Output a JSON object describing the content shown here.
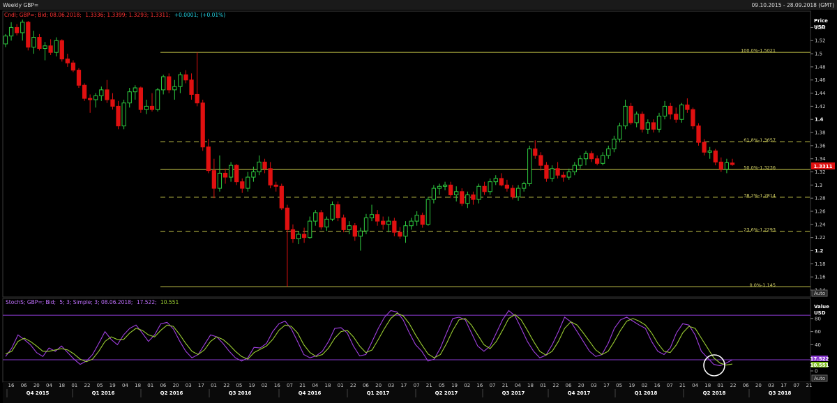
{
  "window": {
    "title": "Weekly GBP=",
    "date_range": "09.10.2015 - 28.09.2018 (GMT)"
  },
  "price_panel": {
    "legend_prefix": "Cndl; GBP=; Bid; 08.06.2018;",
    "legend_values": "1.3336; 1.3399; 1.3293; 1.3311;",
    "legend_change": "+0.0001; (+0.01%)",
    "axis_title_1": "Price",
    "axis_title_2": "USD",
    "last_price": "1.3311",
    "auto_label": "Auto"
  },
  "stoch_panel": {
    "legend_prefix": "StochS; GBP=; Bid;",
    "legend_params": "5; 3; Simple; 3; 08.06.2018;",
    "legend_k": "17.522;",
    "legend_d": "10.551",
    "axis_title_1": "Value",
    "axis_title_2": "USD",
    "k_value": "17.522",
    "d_value": "10.551",
    "auto_label": "Auto"
  },
  "colors": {
    "background": "#000000",
    "up_candle": "#2ecc40",
    "down_candle": "#e01010",
    "fib_line": "#c8c84a",
    "stoch_k": "#a040e0",
    "stoch_d": "#9acd32",
    "stoch_band": "#8a3ad0"
  },
  "chart_data": [
    {
      "type": "candlestick",
      "title": "Weekly GBP=",
      "ylabel": "Price USD",
      "ylim": [
        1.14,
        1.55
      ],
      "y_ticks": [
        1.14,
        1.16,
        1.18,
        1.2,
        1.22,
        1.24,
        1.26,
        1.28,
        1.3,
        1.32,
        1.34,
        1.36,
        1.38,
        1.4,
        1.42,
        1.44,
        1.46,
        1.48,
        1.5,
        1.52,
        1.54
      ],
      "y_tick_labels": [
        "1.14",
        "1.16",
        "1.18",
        "1.2",
        "1.22",
        "1.24",
        "1.26",
        "1.28",
        "1.3",
        "1.32",
        "1.34",
        "1.36",
        "1.38",
        "1.4",
        "1.42",
        "1.44",
        "1.46",
        "1.48",
        "1.5",
        "1.52",
        "1.54"
      ],
      "x_tick_labels": [
        "16",
        "06",
        "20",
        "04",
        "18",
        "01",
        "22",
        "05",
        "19",
        "04",
        "18",
        "01",
        "06",
        "20",
        "03",
        "17",
        "01",
        "22",
        "05",
        "19",
        "02",
        "16",
        "07",
        "21",
        "04",
        "18",
        "01",
        "22",
        "06",
        "20",
        "03",
        "17",
        "07",
        "21",
        "05",
        "19",
        "02",
        "16",
        "07",
        "21",
        "04",
        "18",
        "01",
        "22",
        "06",
        "20",
        "03",
        "17",
        "05",
        "19",
        "02",
        "16",
        "07",
        "21",
        "04",
        "18",
        "01",
        "22",
        "06",
        "20",
        "03",
        "17",
        "07",
        "21"
      ],
      "quarter_labels": [
        "Q4 2015",
        "Q1 2016",
        "Q2 2016",
        "Q3 2016",
        "Q4 2016",
        "Q1 2017",
        "Q2 2017",
        "Q3 2017",
        "Q4 2017",
        "Q1 2018",
        "Q2 2018",
        "Q3 2018"
      ],
      "fibonacci": [
        {
          "label": "100.0%-1.5021",
          "value": 1.5021,
          "style": "solid"
        },
        {
          "label": "61.8%-1.3657",
          "value": 1.3657,
          "style": "dashed"
        },
        {
          "label": "50.0%-1.3236",
          "value": 1.3236,
          "style": "solid"
        },
        {
          "label": "38.2%-1.2814",
          "value": 1.2814,
          "style": "dashed"
        },
        {
          "label": "23.6%-1.2293",
          "value": 1.2293,
          "style": "dashed"
        },
        {
          "label": "0.0%-1.145",
          "value": 1.145,
          "style": "solid"
        }
      ],
      "candles": [
        [
          1.515,
          1.53,
          1.51,
          1.527
        ],
        [
          1.527,
          1.548,
          1.52,
          1.54
        ],
        [
          1.54,
          1.545,
          1.528,
          1.532
        ],
        [
          1.532,
          1.552,
          1.52,
          1.548
        ],
        [
          1.548,
          1.55,
          1.505,
          1.51
        ],
        [
          1.51,
          1.535,
          1.5,
          1.525
        ],
        [
          1.525,
          1.53,
          1.505,
          1.508
        ],
        [
          1.508,
          1.518,
          1.49,
          1.512
        ],
        [
          1.512,
          1.522,
          1.498,
          1.502
        ],
        [
          1.502,
          1.525,
          1.496,
          1.52
        ],
        [
          1.52,
          1.522,
          1.488,
          1.492
        ],
        [
          1.492,
          1.5,
          1.48,
          1.486
        ],
        [
          1.486,
          1.49,
          1.472,
          1.475
        ],
        [
          1.475,
          1.478,
          1.448,
          1.452
        ],
        [
          1.452,
          1.455,
          1.428,
          1.432
        ],
        [
          1.432,
          1.438,
          1.41,
          1.43
        ],
        [
          1.43,
          1.44,
          1.418,
          1.436
        ],
        [
          1.436,
          1.45,
          1.428,
          1.445
        ],
        [
          1.445,
          1.46,
          1.425,
          1.43
        ],
        [
          1.43,
          1.44,
          1.415,
          1.42
        ],
        [
          1.42,
          1.428,
          1.385,
          1.39
        ],
        [
          1.39,
          1.43,
          1.385,
          1.425
        ],
        [
          1.425,
          1.448,
          1.418,
          1.442
        ],
        [
          1.442,
          1.452,
          1.43,
          1.448
        ],
        [
          1.448,
          1.45,
          1.41,
          1.415
        ],
        [
          1.415,
          1.43,
          1.408,
          1.42
        ],
        [
          1.42,
          1.44,
          1.412,
          1.415
        ],
        [
          1.415,
          1.448,
          1.412,
          1.445
        ],
        [
          1.445,
          1.468,
          1.438,
          1.465
        ],
        [
          1.465,
          1.47,
          1.44,
          1.445
        ],
        [
          1.445,
          1.46,
          1.43,
          1.45
        ],
        [
          1.45,
          1.472,
          1.44,
          1.468
        ],
        [
          1.468,
          1.475,
          1.455,
          1.46
        ],
        [
          1.46,
          1.47,
          1.43,
          1.438
        ],
        [
          1.438,
          1.502,
          1.42,
          1.425
        ],
        [
          1.425,
          1.43,
          1.352,
          1.358
        ],
        [
          1.358,
          1.37,
          1.318,
          1.322
        ],
        [
          1.322,
          1.34,
          1.28,
          1.295
        ],
        [
          1.295,
          1.345,
          1.29,
          1.318
        ],
        [
          1.318,
          1.325,
          1.302,
          1.312
        ],
        [
          1.312,
          1.335,
          1.305,
          1.33
        ],
        [
          1.33,
          1.332,
          1.3,
          1.305
        ],
        [
          1.305,
          1.31,
          1.288,
          1.295
        ],
        [
          1.295,
          1.32,
          1.29,
          1.312
        ],
        [
          1.312,
          1.328,
          1.305,
          1.32
        ],
        [
          1.32,
          1.345,
          1.315,
          1.335
        ],
        [
          1.335,
          1.34,
          1.318,
          1.325
        ],
        [
          1.325,
          1.335,
          1.295,
          1.3
        ],
        [
          1.3,
          1.305,
          1.29,
          1.298
        ],
        [
          1.298,
          1.302,
          1.262,
          1.265
        ],
        [
          1.265,
          1.27,
          1.145,
          1.232
        ],
        [
          1.232,
          1.24,
          1.212,
          1.218
        ],
        [
          1.218,
          1.23,
          1.21,
          1.225
        ],
        [
          1.225,
          1.235,
          1.212,
          1.22
        ],
        [
          1.22,
          1.252,
          1.218,
          1.245
        ],
        [
          1.245,
          1.262,
          1.238,
          1.258
        ],
        [
          1.258,
          1.262,
          1.232,
          1.236
        ],
        [
          1.236,
          1.252,
          1.23,
          1.248
        ],
        [
          1.248,
          1.275,
          1.245,
          1.27
        ],
        [
          1.27,
          1.275,
          1.245,
          1.25
        ],
        [
          1.25,
          1.255,
          1.228,
          1.232
        ],
        [
          1.232,
          1.245,
          1.225,
          1.238
        ],
        [
          1.238,
          1.242,
          1.215,
          1.222
        ],
        [
          1.222,
          1.235,
          1.2,
          1.23
        ],
        [
          1.23,
          1.256,
          1.225,
          1.25
        ],
        [
          1.25,
          1.27,
          1.245,
          1.255
        ],
        [
          1.255,
          1.262,
          1.238,
          1.245
        ],
        [
          1.245,
          1.252,
          1.232,
          1.24
        ],
        [
          1.24,
          1.252,
          1.228,
          1.245
        ],
        [
          1.245,
          1.25,
          1.222,
          1.228
        ],
        [
          1.228,
          1.236,
          1.218,
          1.222
        ],
        [
          1.222,
          1.245,
          1.212,
          1.238
        ],
        [
          1.238,
          1.25,
          1.232,
          1.245
        ],
        [
          1.245,
          1.26,
          1.238,
          1.254
        ],
        [
          1.254,
          1.258,
          1.235,
          1.24
        ],
        [
          1.24,
          1.282,
          1.238,
          1.278
        ],
        [
          1.278,
          1.3,
          1.272,
          1.295
        ],
        [
          1.295,
          1.302,
          1.285,
          1.298
        ],
        [
          1.298,
          1.305,
          1.292,
          1.3
        ],
        [
          1.3,
          1.305,
          1.28,
          1.285
        ],
        [
          1.285,
          1.298,
          1.275,
          1.29
        ],
        [
          1.29,
          1.295,
          1.268,
          1.272
        ],
        [
          1.272,
          1.29,
          1.265,
          1.285
        ],
        [
          1.285,
          1.29,
          1.27,
          1.278
        ],
        [
          1.278,
          1.302,
          1.272,
          1.298
        ],
        [
          1.298,
          1.305,
          1.285,
          1.29
        ],
        [
          1.29,
          1.31,
          1.285,
          1.305
        ],
        [
          1.305,
          1.315,
          1.3,
          1.31
        ],
        [
          1.31,
          1.318,
          1.298,
          1.3
        ],
        [
          1.3,
          1.308,
          1.29,
          1.295
        ],
        [
          1.295,
          1.3,
          1.278,
          1.282
        ],
        [
          1.282,
          1.3,
          1.276,
          1.295
        ],
        [
          1.295,
          1.305,
          1.29,
          1.302
        ],
        [
          1.302,
          1.36,
          1.298,
          1.355
        ],
        [
          1.355,
          1.368,
          1.34,
          1.345
        ],
        [
          1.345,
          1.35,
          1.322,
          1.33
        ],
        [
          1.33,
          1.335,
          1.305,
          1.31
        ],
        [
          1.31,
          1.33,
          1.305,
          1.325
        ],
        [
          1.325,
          1.335,
          1.31,
          1.315
        ],
        [
          1.315,
          1.32,
          1.305,
          1.312
        ],
        [
          1.312,
          1.325,
          1.308,
          1.32
        ],
        [
          1.32,
          1.335,
          1.315,
          1.33
        ],
        [
          1.33,
          1.345,
          1.325,
          1.34
        ],
        [
          1.34,
          1.352,
          1.33,
          1.348
        ],
        [
          1.348,
          1.352,
          1.335,
          1.34
        ],
        [
          1.34,
          1.345,
          1.33,
          1.333
        ],
        [
          1.333,
          1.35,
          1.33,
          1.345
        ],
        [
          1.345,
          1.36,
          1.34,
          1.355
        ],
        [
          1.355,
          1.375,
          1.35,
          1.37
        ],
        [
          1.37,
          1.395,
          1.365,
          1.39
        ],
        [
          1.39,
          1.43,
          1.385,
          1.42
        ],
        [
          1.42,
          1.425,
          1.392,
          1.395
        ],
        [
          1.395,
          1.412,
          1.388,
          1.408
        ],
        [
          1.408,
          1.412,
          1.38,
          1.385
        ],
        [
          1.385,
          1.4,
          1.378,
          1.395
        ],
        [
          1.395,
          1.4,
          1.38,
          1.385
        ],
        [
          1.385,
          1.41,
          1.38,
          1.405
        ],
        [
          1.405,
          1.428,
          1.4,
          1.42
        ],
        [
          1.42,
          1.425,
          1.4,
          1.408
        ],
        [
          1.408,
          1.418,
          1.395,
          1.4
        ],
        [
          1.4,
          1.425,
          1.395,
          1.422
        ],
        [
          1.422,
          1.432,
          1.41,
          1.415
        ],
        [
          1.415,
          1.418,
          1.385,
          1.39
        ],
        [
          1.39,
          1.394,
          1.36,
          1.365
        ],
        [
          1.365,
          1.37,
          1.345,
          1.35
        ],
        [
          1.35,
          1.358,
          1.34,
          1.352
        ],
        [
          1.352,
          1.355,
          1.33,
          1.335
        ],
        [
          1.335,
          1.342,
          1.32,
          1.324
        ],
        [
          1.324,
          1.34,
          1.318,
          1.334
        ],
        [
          1.3336,
          1.3399,
          1.3293,
          1.3311
        ]
      ]
    },
    {
      "type": "line",
      "title": "StochS; GBP=; Bid; 5; 3; Simple; 3",
      "ylabel": "Value USD",
      "ylim": [
        0,
        100
      ],
      "y_ticks": [
        0,
        20,
        40,
        60,
        80
      ],
      "y_tick_labels": [
        "0",
        "20",
        "40",
        "60",
        "80"
      ],
      "overbought_line": 85,
      "oversold_line": 17,
      "series": [
        {
          "name": "%K",
          "values": [
            22,
            35,
            55,
            48,
            40,
            28,
            22,
            35,
            30,
            38,
            28,
            18,
            10,
            15,
            25,
            42,
            60,
            48,
            40,
            55,
            65,
            70,
            58,
            45,
            55,
            72,
            74,
            64,
            46,
            30,
            20,
            25,
            40,
            55,
            52,
            42,
            30,
            20,
            15,
            20,
            36,
            35,
            42,
            60,
            72,
            76,
            64,
            45,
            25,
            20,
            23,
            30,
            45,
            65,
            66,
            58,
            38,
            23,
            25,
            45,
            65,
            82,
            92,
            90,
            78,
            58,
            40,
            30,
            15,
            18,
            35,
            58,
            80,
            82,
            78,
            58,
            38,
            30,
            38,
            58,
            78,
            92,
            84,
            65,
            45,
            30,
            20,
            24,
            40,
            60,
            82,
            75,
            60,
            45,
            30,
            22,
            25,
            42,
            65,
            78,
            82,
            76,
            70,
            65,
            45,
            30,
            25,
            35,
            58,
            72,
            70,
            55,
            30,
            20,
            10,
            8,
            12,
            17
          ]
        },
        {
          "name": "%D",
          "values": [
            26,
            30,
            45,
            50,
            45,
            38,
            30,
            30,
            32,
            34,
            32,
            26,
            18,
            14,
            18,
            30,
            45,
            52,
            48,
            48,
            58,
            65,
            62,
            55,
            52,
            62,
            70,
            68,
            56,
            42,
            30,
            25,
            32,
            45,
            52,
            48,
            40,
            30,
            22,
            18,
            28,
            33,
            38,
            48,
            62,
            70,
            68,
            58,
            40,
            28,
            22,
            25,
            35,
            50,
            60,
            62,
            52,
            38,
            28,
            32,
            48,
            65,
            80,
            88,
            84,
            72,
            55,
            40,
            26,
            20,
            25,
            42,
            62,
            78,
            80,
            70,
            55,
            40,
            34,
            45,
            62,
            80,
            86,
            78,
            62,
            45,
            30,
            24,
            30,
            45,
            65,
            75,
            70,
            58,
            45,
            32,
            25,
            30,
            45,
            62,
            76,
            80,
            76,
            70,
            58,
            42,
            30,
            28,
            40,
            58,
            68,
            65,
            50,
            35,
            20,
            12,
            9,
            10.551
          ]
        }
      ]
    }
  ]
}
